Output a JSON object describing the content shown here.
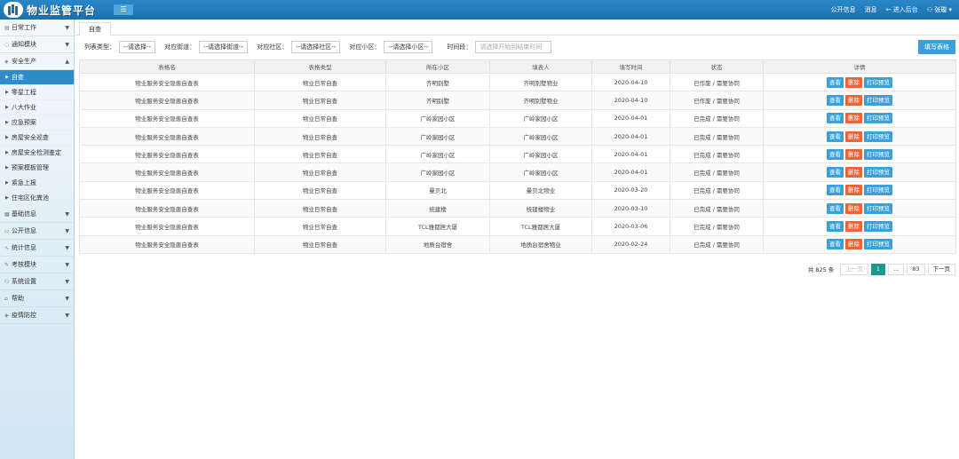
{
  "header": {
    "app_title": "物业监管平台",
    "menu_toggle_icon": "hamburger-icon",
    "links": {
      "public_info": "公开信息",
      "messages": "消息",
      "enter_backend": "进入后台",
      "user": "张璇"
    }
  },
  "sidebar": {
    "groups": [
      {
        "label": "日常工作",
        "icon": "calendar-icon"
      },
      {
        "label": "通知模块",
        "icon": "bell-icon"
      },
      {
        "label": "安全生产",
        "icon": "shield-icon",
        "expanded": true
      }
    ],
    "sub_items": [
      {
        "label": "自查",
        "active": true
      },
      {
        "label": "零星工程"
      },
      {
        "label": "八大作业"
      },
      {
        "label": "应急预案"
      },
      {
        "label": "房屋安全巡查"
      },
      {
        "label": "房屋安全检测鉴定"
      },
      {
        "label": "预案模板管理"
      },
      {
        "label": "紧急上报"
      },
      {
        "label": "住宅区化粪池"
      }
    ],
    "groups_after": [
      {
        "label": "基础信息",
        "icon": "grid-icon"
      },
      {
        "label": "公开信息",
        "icon": "document-icon"
      },
      {
        "label": "统计信息",
        "icon": "chart-icon"
      },
      {
        "label": "考核模块",
        "icon": "edit-icon"
      },
      {
        "label": "系统设置",
        "icon": "user-icon"
      },
      {
        "label": "帮助",
        "icon": "help-icon"
      },
      {
        "label": "疫情防控",
        "icon": "shield-icon"
      }
    ]
  },
  "tabs": [
    {
      "label": "自查"
    }
  ],
  "filters": {
    "form_type": {
      "label": "列表类型：",
      "value": "--请选择--"
    },
    "street": {
      "label": "对应街道：",
      "value": "--请选择街道--"
    },
    "community": {
      "label": "对应社区：",
      "value": "--请选择社区--"
    },
    "estate": {
      "label": "对应小区：",
      "value": "--请选择小区--"
    },
    "date_range": {
      "label": "时间段：",
      "placeholder": "请选择开始到结束时间"
    }
  },
  "fill_form_button": "填写表格",
  "table": {
    "columns": [
      "表格名",
      "表格类型",
      "所在小区",
      "填表人",
      "填写时间",
      "状态",
      "详情"
    ],
    "actions": {
      "view": "查看",
      "delete": "删除",
      "print": "打印预览"
    },
    "rows": [
      [
        "物业服务安全隐患自查表",
        "物业日常自查",
        "齐明别墅",
        "齐明别墅物业",
        "2020-04-10",
        "已作废 / 需要协同"
      ],
      [
        "物业服务安全隐患自查表",
        "物业日常自查",
        "齐明别墅",
        "齐明别墅物业",
        "2020-04-10",
        "已作废 / 需要协同"
      ],
      [
        "物业服务安全隐患自查表",
        "物业日常自查",
        "广岭家园小区",
        "广岭家园小区",
        "2020-04-01",
        "已完成 / 需要协同"
      ],
      [
        "物业服务安全隐患自查表",
        "物业日常自查",
        "广岭家园小区",
        "广岭家园小区",
        "2020-04-01",
        "已完成 / 需要协同"
      ],
      [
        "物业服务安全隐患自查表",
        "物业日常自查",
        "广岭家园小区",
        "广岭家园小区",
        "2020-04-01",
        "已完成 / 需要协同"
      ],
      [
        "物业服务安全隐患自查表",
        "物业日常自查",
        "广岭家园小区",
        "广岭家园小区",
        "2020-04-01",
        "已完成 / 需要协同"
      ],
      [
        "物业服务安全隐患自查表",
        "物业日常自查",
        "曼贝北",
        "曼贝北物业",
        "2020-03-20",
        "已完成 / 需要协同"
      ],
      [
        "物业服务安全隐患自查表",
        "物业日常自查",
        "统建楼",
        "统建楼物业",
        "2020-03-10",
        "已完成 / 需要协同"
      ],
      [
        "物业服务安全隐患自查表",
        "物业日常自查",
        "TCL雅都居大厦",
        "TCL雅都居大厦",
        "2020-03-06",
        "已完成 / 需要协同"
      ],
      [
        "物业服务安全隐患自查表",
        "物业日常自查",
        "地质台宿舍",
        "地质台宿舍物业",
        "2020-02-24",
        "已完成 / 需要协同"
      ]
    ]
  },
  "pagination": {
    "total": "共 825 条",
    "prev": "上一页",
    "current": "1",
    "ellipsis": "...",
    "last": "83",
    "next": "下一页"
  }
}
